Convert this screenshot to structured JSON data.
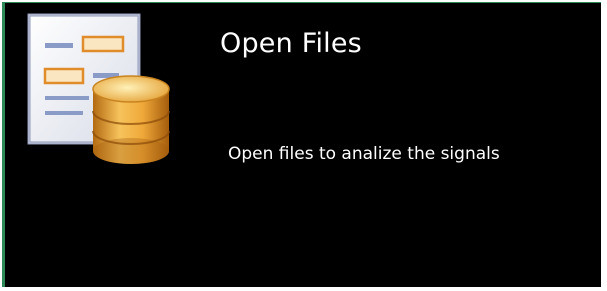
{
  "tile": {
    "title": "Open Files",
    "description": "Open files to analize the signals",
    "icon": "document-database-icon",
    "background_color": "#000000",
    "text_color": "#ffffff",
    "accent_color": "#2f8a5a"
  }
}
